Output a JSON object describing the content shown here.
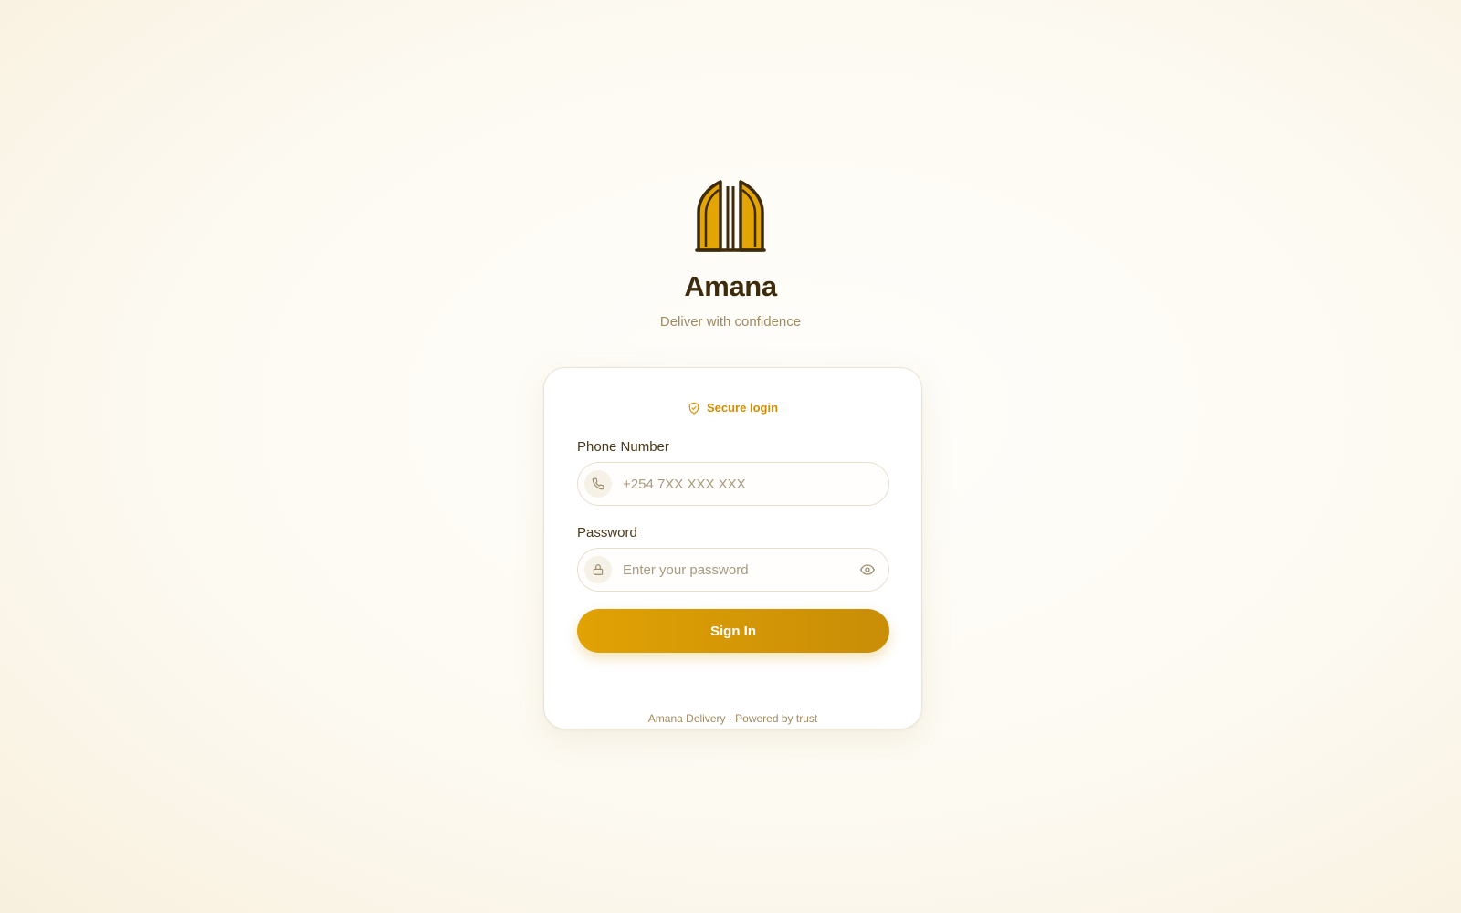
{
  "brand": {
    "logo_icon": "amana-door-logo-icon",
    "app_name": "Amana",
    "tagline": "Deliver with confidence"
  },
  "card": {
    "secure_icon": "shield-check-icon",
    "secure_label": "Secure login",
    "phone": {
      "label": "Phone Number",
      "icon": "phone-icon",
      "placeholder": "+254 7XX XXX XXX",
      "value": ""
    },
    "password": {
      "label": "Password",
      "icon": "lock-icon",
      "toggle_icon": "eye-icon",
      "placeholder": "Enter your password",
      "value": ""
    },
    "signin_label": "Sign In",
    "footer": "Amana Delivery · Powered by trust"
  },
  "colors": {
    "accent": "#e0a204",
    "accent_dark": "#c98d07",
    "title": "#3d2b0b",
    "muted": "#a08a62",
    "secure": "#d08d05"
  }
}
